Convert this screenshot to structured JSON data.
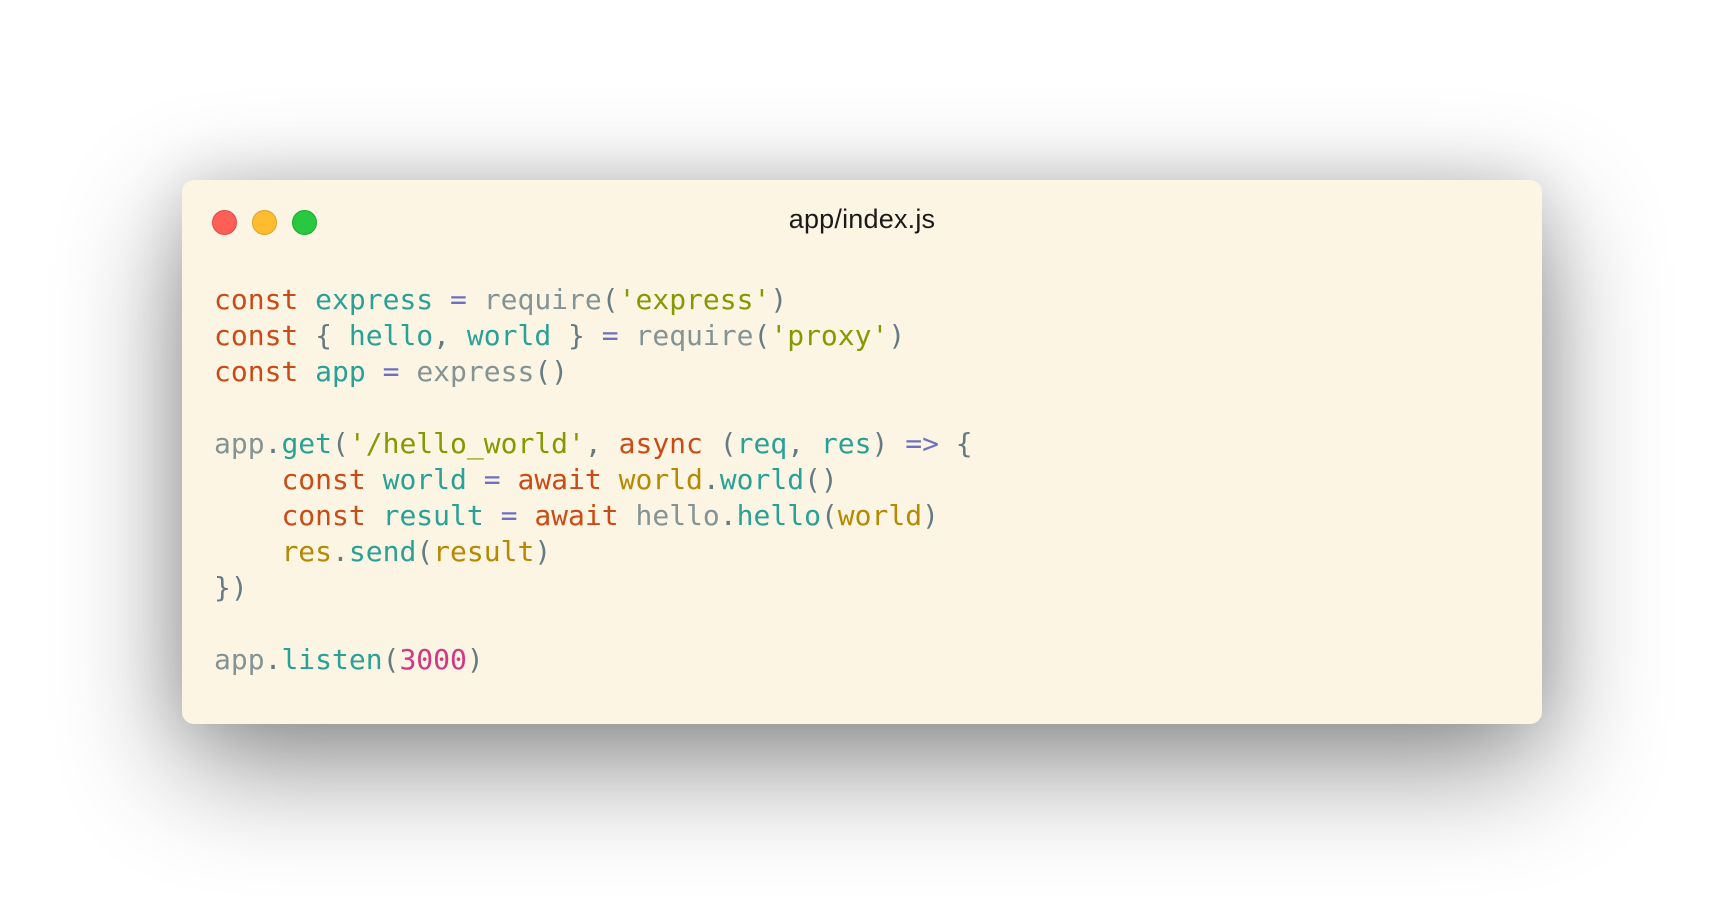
{
  "window": {
    "title": "app/index.js"
  },
  "colors": {
    "background": "#fcf5e3",
    "keyword": "#cb4b16",
    "variable": "#2aa198",
    "operator": "#6c71c4",
    "string": "#859900",
    "number": "#d33682",
    "object": "#b58900",
    "plain": "#657b83",
    "traffic_close": "#ff5f57",
    "traffic_minimize": "#febc2e",
    "traffic_zoom": "#28c840"
  },
  "code": {
    "lines": [
      [
        {
          "t": "const",
          "c": "kw"
        },
        {
          "t": " ",
          "c": "plain"
        },
        {
          "t": "express",
          "c": "var"
        },
        {
          "t": " ",
          "c": "plain"
        },
        {
          "t": "=",
          "c": "op"
        },
        {
          "t": " ",
          "c": "plain"
        },
        {
          "t": "require",
          "c": "fn"
        },
        {
          "t": "(",
          "c": "punc"
        },
        {
          "t": "'express'",
          "c": "str"
        },
        {
          "t": ")",
          "c": "punc"
        }
      ],
      [
        {
          "t": "const",
          "c": "kw"
        },
        {
          "t": " { ",
          "c": "punc"
        },
        {
          "t": "hello",
          "c": "var"
        },
        {
          "t": ", ",
          "c": "punc"
        },
        {
          "t": "world",
          "c": "var"
        },
        {
          "t": " } ",
          "c": "punc"
        },
        {
          "t": "=",
          "c": "op"
        },
        {
          "t": " ",
          "c": "plain"
        },
        {
          "t": "require",
          "c": "fn"
        },
        {
          "t": "(",
          "c": "punc"
        },
        {
          "t": "'proxy'",
          "c": "str"
        },
        {
          "t": ")",
          "c": "punc"
        }
      ],
      [
        {
          "t": "const",
          "c": "kw"
        },
        {
          "t": " ",
          "c": "plain"
        },
        {
          "t": "app",
          "c": "var"
        },
        {
          "t": " ",
          "c": "plain"
        },
        {
          "t": "=",
          "c": "op"
        },
        {
          "t": " ",
          "c": "plain"
        },
        {
          "t": "express",
          "c": "fn"
        },
        {
          "t": "()",
          "c": "punc"
        }
      ],
      [],
      [
        {
          "t": "app",
          "c": "fn"
        },
        {
          "t": ".",
          "c": "punc"
        },
        {
          "t": "get",
          "c": "prop"
        },
        {
          "t": "(",
          "c": "punc"
        },
        {
          "t": "'/hello_world'",
          "c": "str"
        },
        {
          "t": ", ",
          "c": "punc"
        },
        {
          "t": "async",
          "c": "kw"
        },
        {
          "t": " (",
          "c": "punc"
        },
        {
          "t": "req",
          "c": "var"
        },
        {
          "t": ", ",
          "c": "punc"
        },
        {
          "t": "res",
          "c": "var"
        },
        {
          "t": ") ",
          "c": "punc"
        },
        {
          "t": "=>",
          "c": "op"
        },
        {
          "t": " {",
          "c": "punc"
        }
      ],
      [
        {
          "t": "    ",
          "c": "plain"
        },
        {
          "t": "const",
          "c": "kw"
        },
        {
          "t": " ",
          "c": "plain"
        },
        {
          "t": "world",
          "c": "var"
        },
        {
          "t": " ",
          "c": "plain"
        },
        {
          "t": "=",
          "c": "op"
        },
        {
          "t": " ",
          "c": "plain"
        },
        {
          "t": "await",
          "c": "kw"
        },
        {
          "t": " ",
          "c": "plain"
        },
        {
          "t": "world",
          "c": "obj"
        },
        {
          "t": ".",
          "c": "punc"
        },
        {
          "t": "world",
          "c": "prop"
        },
        {
          "t": "()",
          "c": "punc"
        }
      ],
      [
        {
          "t": "    ",
          "c": "plain"
        },
        {
          "t": "const",
          "c": "kw"
        },
        {
          "t": " ",
          "c": "plain"
        },
        {
          "t": "result",
          "c": "var"
        },
        {
          "t": " ",
          "c": "plain"
        },
        {
          "t": "=",
          "c": "op"
        },
        {
          "t": " ",
          "c": "plain"
        },
        {
          "t": "await",
          "c": "kw"
        },
        {
          "t": " ",
          "c": "plain"
        },
        {
          "t": "hello",
          "c": "fn"
        },
        {
          "t": ".",
          "c": "punc"
        },
        {
          "t": "hello",
          "c": "prop"
        },
        {
          "t": "(",
          "c": "punc"
        },
        {
          "t": "world",
          "c": "obj"
        },
        {
          "t": ")",
          "c": "punc"
        }
      ],
      [
        {
          "t": "    ",
          "c": "plain"
        },
        {
          "t": "res",
          "c": "obj"
        },
        {
          "t": ".",
          "c": "punc"
        },
        {
          "t": "send",
          "c": "prop"
        },
        {
          "t": "(",
          "c": "punc"
        },
        {
          "t": "result",
          "c": "obj"
        },
        {
          "t": ")",
          "c": "punc"
        }
      ],
      [
        {
          "t": "})",
          "c": "punc"
        }
      ],
      [],
      [
        {
          "t": "app",
          "c": "fn"
        },
        {
          "t": ".",
          "c": "punc"
        },
        {
          "t": "listen",
          "c": "prop"
        },
        {
          "t": "(",
          "c": "punc"
        },
        {
          "t": "3000",
          "c": "num"
        },
        {
          "t": ")",
          "c": "punc"
        }
      ]
    ]
  }
}
